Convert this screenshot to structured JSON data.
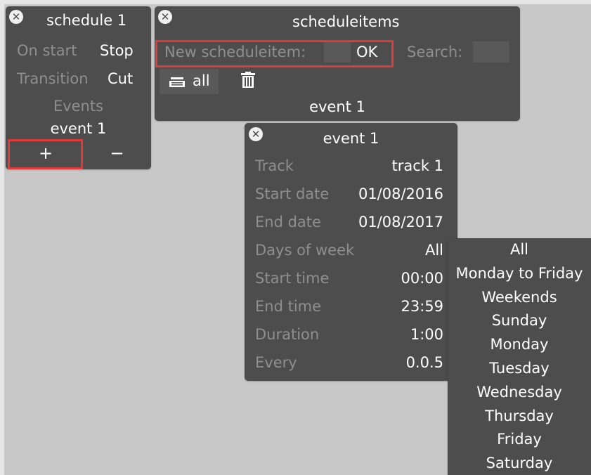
{
  "schedule": {
    "title": "schedule 1",
    "on_start_label": "On start",
    "on_start_value": "Stop",
    "transition_label": "Transition",
    "transition_value": "Cut",
    "events_label": "Events",
    "event_item": "event 1",
    "add_label": "+",
    "remove_label": "−"
  },
  "scheduleitems": {
    "title": "scheduleitems",
    "new_label": "New scheduleitem:",
    "new_value": "",
    "ok_label": "OK",
    "search_label": "Search:",
    "search_value": "",
    "all_label": "all",
    "item": "event 1"
  },
  "event": {
    "title": "event 1",
    "rows": [
      {
        "label": "Track",
        "value": "track 1"
      },
      {
        "label": "Start date",
        "value": "01/08/2016"
      },
      {
        "label": "End date",
        "value": "01/08/2017"
      },
      {
        "label": "Days of week",
        "value": "All"
      },
      {
        "label": "Start time",
        "value": "00:00"
      },
      {
        "label": "End time",
        "value": "23:59"
      },
      {
        "label": "Duration",
        "value": "1:00"
      },
      {
        "label": "Every",
        "value": "0.0.5"
      }
    ]
  },
  "days_dropdown": {
    "options": [
      "All",
      "Monday to Friday",
      "Weekends",
      "Sunday",
      "Monday",
      "Tuesday",
      "Wednesday",
      "Thursday",
      "Friday",
      "Saturday"
    ]
  },
  "colors": {
    "background": "#c8c8c8",
    "panel": "#4d4d4d",
    "label": "#8f8f8f",
    "highlight": "#e03a3a"
  },
  "icons": [
    "close-icon",
    "list-icon",
    "trash-icon"
  ]
}
